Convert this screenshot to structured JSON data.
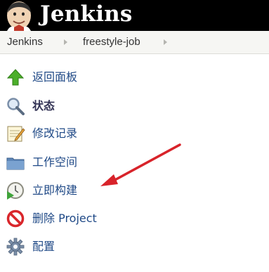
{
  "header": {
    "brand": "Jenkins",
    "logo_icon": "jenkins-butler-logo"
  },
  "breadcrumb": {
    "items": [
      "Jenkins",
      "freestyle-job"
    ]
  },
  "sidebar": {
    "items": [
      {
        "label": "返回面板",
        "icon": "up-arrow-icon"
      },
      {
        "label": "状态",
        "icon": "magnifier-icon"
      },
      {
        "label": "修改记录",
        "icon": "notepad-icon"
      },
      {
        "label": "工作空间",
        "icon": "folder-icon"
      },
      {
        "label": "立即构建",
        "icon": "clock-play-icon"
      },
      {
        "label": "删除 Project",
        "icon": "no-entry-icon"
      },
      {
        "label": "配置",
        "icon": "gear-icon"
      }
    ]
  },
  "colors": {
    "header_bg": "#000000",
    "link": "#204a87",
    "annotation_arrow": "#d8232a"
  }
}
